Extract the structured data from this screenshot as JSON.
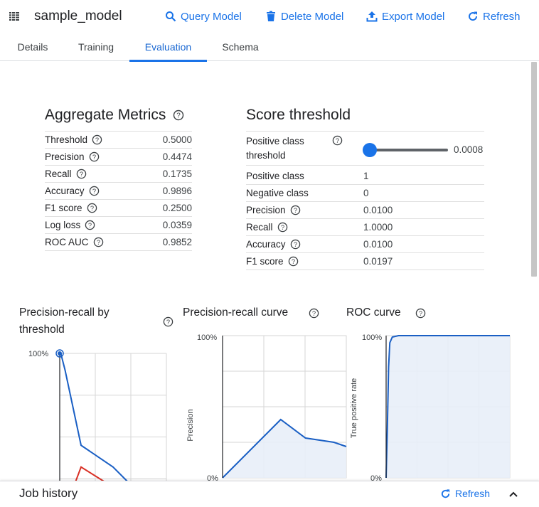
{
  "header": {
    "title": "sample_model",
    "buttons": {
      "query": "Query Model",
      "delete": "Delete Model",
      "export": "Export Model",
      "refresh": "Refresh"
    }
  },
  "tabs": [
    "Details",
    "Training",
    "Evaluation",
    "Schema"
  ],
  "active_tab": "Evaluation",
  "aggregate": {
    "title": "Aggregate Metrics",
    "rows": [
      {
        "label": "Threshold",
        "value": "0.5000"
      },
      {
        "label": "Precision",
        "value": "0.4474"
      },
      {
        "label": "Recall",
        "value": "0.1735"
      },
      {
        "label": "Accuracy",
        "value": "0.9896"
      },
      {
        "label": "F1 score",
        "value": "0.2500"
      },
      {
        "label": "Log loss",
        "value": "0.0359"
      },
      {
        "label": "ROC AUC",
        "value": "0.9852"
      }
    ]
  },
  "score": {
    "title": "Score threshold",
    "threshold_label_1": "Positive class",
    "threshold_label_2": "threshold",
    "threshold_value": "0.0008",
    "rows": [
      {
        "label": "Positive class",
        "value": "1",
        "help": false
      },
      {
        "label": "Negative class",
        "value": "0",
        "help": false
      },
      {
        "label": "Precision",
        "value": "0.0100",
        "help": true
      },
      {
        "label": "Recall",
        "value": "1.0000",
        "help": true
      },
      {
        "label": "Accuracy",
        "value": "0.0100",
        "help": true
      },
      {
        "label": "F1 score",
        "value": "0.0197",
        "help": true
      }
    ]
  },
  "charts": {
    "pr_threshold": {
      "title_1": "Precision-recall by",
      "title_2": "threshold",
      "ytick": "100%"
    },
    "pr_curve": {
      "title": "Precision-recall curve",
      "ylabel": "Precision",
      "ytick_top": "100%",
      "ytick_bottom": "0%"
    },
    "roc": {
      "title": "ROC curve",
      "ylabel": "True positive rate",
      "ytick_top": "100%",
      "ytick_bottom": "0%"
    }
  },
  "chart_data": [
    {
      "type": "line",
      "title": "Precision-recall by threshold",
      "ylim": [
        0,
        1
      ],
      "series": [
        {
          "color": "#1a5fc4",
          "x": [
            0,
            0.01,
            0.05,
            0.1,
            0.2,
            0.5,
            1.0
          ],
          "y": [
            1.0,
            1.0,
            0.9,
            0.75,
            0.45,
            0.32,
            0.0
          ]
        },
        {
          "color": "#d93025",
          "x": [
            0,
            0.05,
            0.1,
            0.2,
            0.5,
            1.0
          ],
          "y": [
            0.0,
            0.05,
            0.15,
            0.32,
            0.2,
            0.0
          ]
        }
      ]
    },
    {
      "type": "area",
      "title": "Precision-recall curve",
      "ylabel": "Precision",
      "ylim": [
        0,
        1
      ],
      "x": [
        0,
        0.47,
        0.67,
        0.9,
        1.0
      ],
      "y": [
        0,
        0.41,
        0.28,
        0.25,
        0.22
      ]
    },
    {
      "type": "area",
      "title": "ROC curve",
      "ylabel": "True positive rate",
      "ylim": [
        0,
        1
      ],
      "x": [
        0,
        0.01,
        0.02,
        0.03,
        0.05,
        0.1,
        1.0
      ],
      "y": [
        0,
        0.35,
        0.78,
        0.95,
        0.99,
        1.0,
        1.0
      ]
    }
  ],
  "footer": {
    "title": "Job history",
    "refresh": "Refresh"
  },
  "colors": {
    "accent": "#1a73e8",
    "curve": "#1a5fc4",
    "fill": "#e8eef8",
    "red": "#d93025"
  }
}
